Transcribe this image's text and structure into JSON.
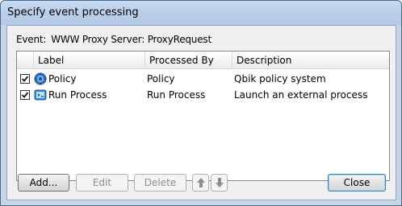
{
  "window": {
    "title": "Specify event processing"
  },
  "event": {
    "label": "Event:",
    "value": "WWW Proxy Server: ProxyRequest"
  },
  "table": {
    "columns": [
      "Label",
      "Processed By",
      "Description"
    ],
    "rows": [
      {
        "checked": true,
        "icon": "gear-globe-icon",
        "label": "Policy",
        "processed_by": "Policy",
        "description": "Qbik policy system"
      },
      {
        "checked": true,
        "icon": "run-process-icon",
        "label": "Run Process",
        "processed_by": "Run Process",
        "description": "Launch an external process"
      }
    ]
  },
  "buttons": {
    "add": "Add...",
    "edit": "Edit",
    "delete": "Delete",
    "move_up_icon": "arrow-up-icon",
    "move_down_icon": "arrow-down-icon",
    "close": "Close"
  },
  "colors": {
    "titlebar": "#b9cfe9",
    "frame": "#c7d5e6",
    "default_button_border": "#3c7fb1"
  }
}
